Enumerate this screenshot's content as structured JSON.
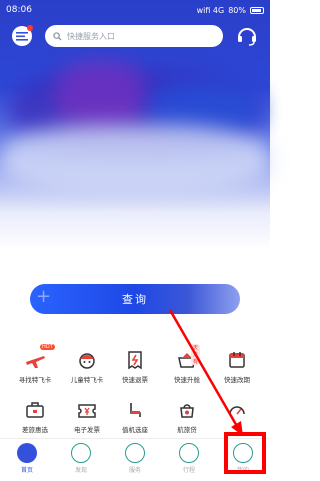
{
  "status_bar": {
    "time": "08:06",
    "network": "4G",
    "signal_icons": "wifi 4G",
    "battery": "80%"
  },
  "topbar": {
    "search_placeholder": "快捷服务入口"
  },
  "main": {
    "query_button_label": "查询"
  },
  "grid": [
    {
      "label": "寻找特飞卡",
      "icon": "plane-icon",
      "badge": "HOT"
    },
    {
      "label": "儿童特飞卡",
      "icon": "child-face-icon"
    },
    {
      "label": "快速退票",
      "icon": "refund-ticket-icon"
    },
    {
      "label": "快速升舱",
      "icon": "upgrade-icon",
      "badge": "天天有"
    },
    {
      "label": "快速改期",
      "icon": "calendar-icon"
    },
    {
      "label": "差旅惠选",
      "icon": "briefcase-icon"
    },
    {
      "label": "电子发票",
      "icon": "invoice-icon"
    },
    {
      "label": "值机选座",
      "icon": "seat-icon"
    },
    {
      "label": "航旅贷",
      "icon": "loan-icon"
    },
    {
      "label": "",
      "icon": "more-icon"
    }
  ],
  "tabbar": [
    {
      "label": "首页",
      "icon": "home-icon"
    },
    {
      "label": "发现",
      "icon": "discover-icon"
    },
    {
      "label": "服务",
      "icon": "service-icon"
    },
    {
      "label": "行程",
      "icon": "trip-icon"
    },
    {
      "label": "我的",
      "icon": "profile-icon"
    }
  ],
  "colors": {
    "primary": "#2e47d6",
    "accent_red": "#ff0000",
    "icon_red": "#e8403a"
  }
}
